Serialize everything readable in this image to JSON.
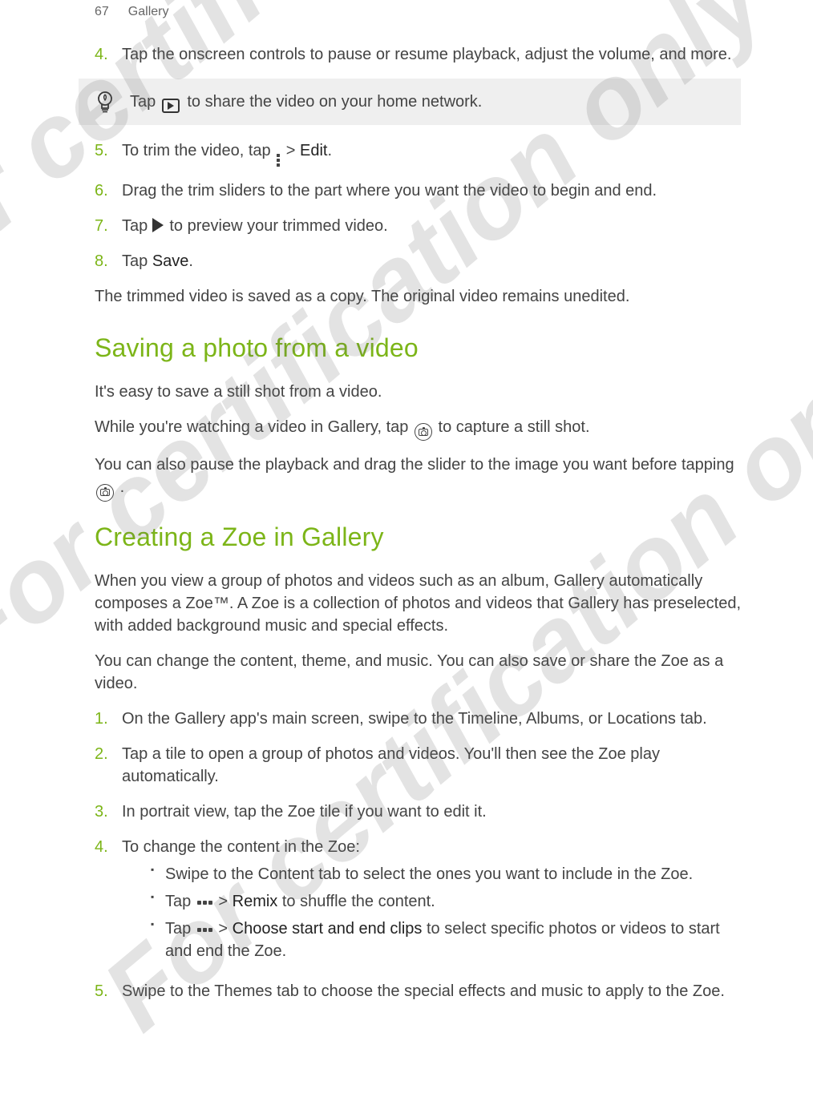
{
  "header": {
    "page_number": "67",
    "section": "Gallery"
  },
  "steps_top": {
    "s4": "Tap the onscreen controls to pause or resume playback, adjust the volume, and more.",
    "tip_before": "Tap ",
    "tip_after": " to share the video on your home network.",
    "s5_before": "To trim the video, tap ",
    "s5_after": " > ",
    "s5_edit": "Edit",
    "s5_end": ".",
    "s6": "Drag the trim sliders to the part where you want the video to begin and end.",
    "s7_before": "Tap ",
    "s7_after": " to preview your trimmed video.",
    "s8_before": "Tap ",
    "s8_save": "Save",
    "s8_end": ".",
    "note": "The trimmed video is saved as a copy. The original video remains unedited."
  },
  "section_saving": {
    "heading": "Saving a photo from a video",
    "p1": "It's easy to save a still shot from a video.",
    "p2_before": "While you're watching a video in Gallery, tap ",
    "p2_after": " to capture a still shot.",
    "p3_before": "You can also pause the playback and drag the slider to the image you want before tapping ",
    "p3_after": "."
  },
  "section_zoe": {
    "heading": "Creating a Zoe in Gallery",
    "p1": "When you view a group of photos and videos such as an album, Gallery automatically composes a Zoe™. A Zoe is a collection of photos and videos that Gallery has preselected, with added background music and special effects.",
    "p2": "You can change the content, theme, and music. You can also save or share the Zoe as a video.",
    "steps": {
      "s1": "On the Gallery app's main screen, swipe to the Timeline, Albums, or Locations tab.",
      "s2": "Tap a tile to open a group of photos and videos. You'll then see the Zoe play automatically.",
      "s3": "In portrait view, tap the Zoe tile if you want to edit it.",
      "s4": "To change the content in the Zoe:",
      "b1": "Swipe to the Content tab to select the ones you want to include in the Zoe.",
      "b2_before": "Tap ",
      "b2_mid": " > ",
      "b2_remix": "Remix",
      "b2_after": " to shuffle the content.",
      "b3_before": "Tap ",
      "b3_mid": " > ",
      "b3_choose": "Choose start and end clips",
      "b3_after": " to select specific photos or videos to start and end the Zoe.",
      "s5": "Swipe to the Themes tab to choose the special effects and music to apply to the Zoe."
    }
  }
}
